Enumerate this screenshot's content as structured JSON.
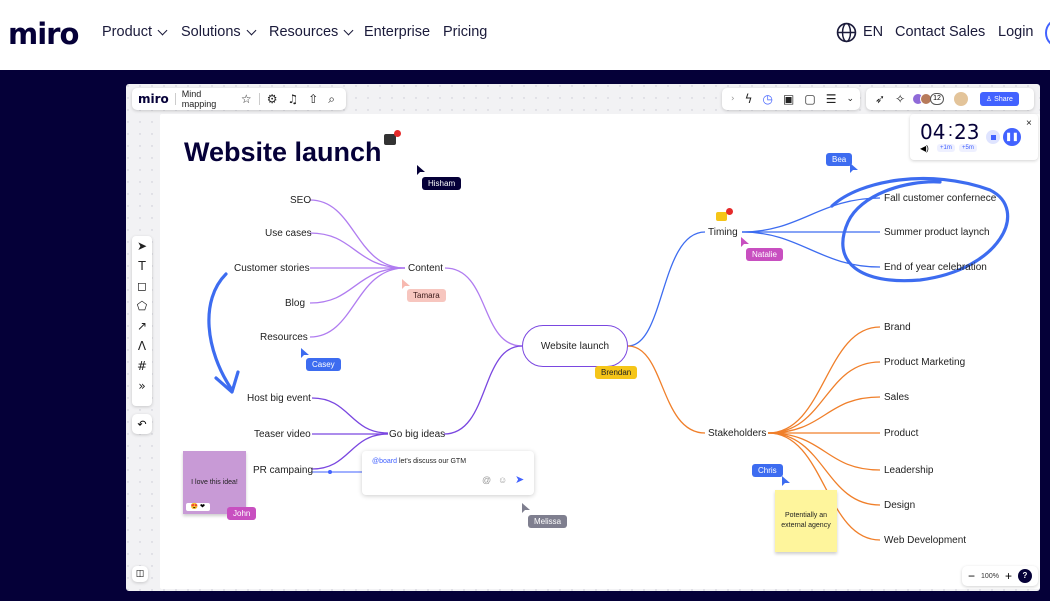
{
  "nav": {
    "logo": "miro",
    "items": [
      "Product",
      "Solutions",
      "Resources",
      "Enterprise",
      "Pricing"
    ],
    "lang": "EN",
    "contact": "Contact Sales",
    "login": "Login"
  },
  "app": {
    "logo": "miro",
    "board_name": "Mind mapping",
    "share": "Share",
    "avatar_count": "12",
    "zoom": "100%",
    "help": "?"
  },
  "timer": {
    "minutes": "04",
    "seconds": "23",
    "plus1": "+1m",
    "plus5": "+5m"
  },
  "board": {
    "title": "Website launch",
    "center": "Website launch",
    "content": "Content",
    "content_children": [
      "SEO",
      "Use cases",
      "Customer stories",
      "Blog",
      "Resources"
    ],
    "go_big": "Go big ideas",
    "go_big_children": [
      "Host big event",
      "Teaser video",
      "PR campaing"
    ],
    "timing": "Timing",
    "timing_children": [
      "Fall customer confernece",
      "Summer product laynch",
      "End of year celebration"
    ],
    "stakeholders": "Stakeholders",
    "stakeholders_children": [
      "Brand",
      "Product Marketing",
      "Sales",
      "Product",
      "Leadership",
      "Design",
      "Web Development"
    ],
    "sticky_purple": "I love this idea!",
    "sticky_yellow": "Potentially an external agency",
    "comment_mention": "@board",
    "comment_text": " let's discuss our GTM",
    "cursors": [
      "Hisham",
      "Tamara",
      "Casey",
      "Brendan",
      "Natalie",
      "Bea",
      "Chris",
      "John",
      "Melissa"
    ]
  },
  "colors": {
    "purple": "#a468ec",
    "blue": "#3d6cf0",
    "orange": "#f07f2a",
    "navy": "#050038"
  }
}
